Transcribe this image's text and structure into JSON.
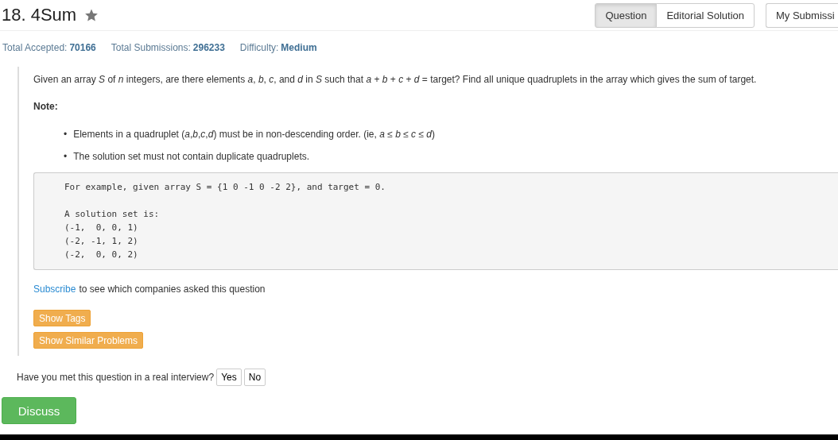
{
  "title": "18. 4Sum",
  "tabs": [
    {
      "label": "Question",
      "selected": true
    },
    {
      "label": "Editorial Solution",
      "selected": false
    },
    {
      "label": "My Submissi",
      "selected": false
    }
  ],
  "stats": [
    {
      "label": "Total Accepted:",
      "value": "70166"
    },
    {
      "label": "Total Submissions:",
      "value": "296233"
    },
    {
      "label": "Difficulty:",
      "value": "Medium"
    }
  ],
  "description": "Given an array *S* of *n* integers, are there elements *a*, *b*, *c*, and *d* in *S* such that *a* + *b* + *c* + *d* = target? Find all unique quadruplets in the array which gives the sum of target.",
  "note_heading": "Note:",
  "notes": [
    {
      "bullet": "•",
      "text": "Elements in a quadruplet (*a*,*b*,*c*,*d*) must be in non-descending order. (ie, *a* ≤ *b* ≤ *c* ≤ *d*)"
    },
    {
      "bullet": "•",
      "text": "The solution set must not contain duplicate quadruplets."
    }
  ],
  "example": {
    "intro": "For example, given array S = {1 0 -1 0 -2 2}, and target = 0.",
    "solution_heading": "A solution set is:",
    "solutions": [
      "(-1,  0, 0, 1)",
      "(-2, -1, 1, 2)",
      "(-2,  0, 0, 2)"
    ]
  },
  "subscribe": {
    "link": "Subscribe",
    "text": "to see which companies asked this question"
  },
  "buttons": [
    "Show Tags",
    "Show Similar Problems"
  ],
  "interview": {
    "question": "Have you met this question in a real interview?",
    "answers": [
      "Yes",
      "No"
    ]
  },
  "discuss": "Discuss"
}
